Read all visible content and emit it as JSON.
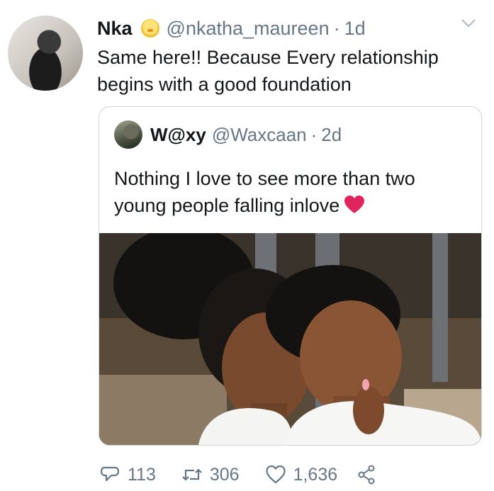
{
  "tweet": {
    "author_name": "Nka",
    "author_handle": "@nkatha_maureen",
    "separator": "·",
    "time": "1d",
    "text": "Same here!! Because Every relationship begins with a good foundation"
  },
  "quoted_tweet": {
    "author_name": "W@xy",
    "author_handle": "@Waxcaan",
    "separator": "·",
    "time": "2d",
    "text": "Nothing I love to see more than two young people falling inlove"
  },
  "actions": {
    "replies": "113",
    "retweets": "306",
    "likes": "1,636"
  },
  "icons": {
    "author_badge": "hatching-chick-emoji",
    "menu": "chevron-down-icon",
    "heart_emoji": "red-heart-emoji",
    "reply": "reply-icon",
    "retweet": "retweet-icon",
    "like": "like-icon",
    "share": "share-icon"
  },
  "colors": {
    "text": "#14171a",
    "secondary": "#657786",
    "border": "#ccd6dd",
    "heart": "#e0245e"
  }
}
